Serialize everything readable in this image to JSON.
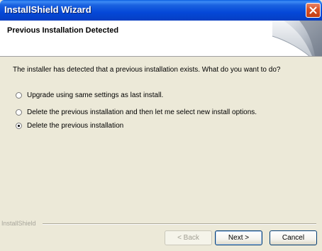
{
  "window": {
    "title": "InstallShield Wizard"
  },
  "header": {
    "title": "Previous Installation Detected"
  },
  "body": {
    "prompt": "The installer has detected that a previous installation exists.  What do you want to do?",
    "options": [
      {
        "label": "Upgrade using same settings as last install.",
        "selected": false
      },
      {
        "label": "Delete the previous installation and then let me select new install options.",
        "selected": false
      },
      {
        "label": "Delete the previous installation",
        "selected": true
      }
    ]
  },
  "footer": {
    "brand": "InstallShield",
    "back_label": "< Back",
    "next_label": "Next >",
    "cancel_label": "Cancel"
  },
  "icons": {
    "close": "close-icon",
    "radio": "radio-icon"
  },
  "colors": {
    "titlebar": "#0548d8",
    "close_button": "#d9542a",
    "dialog_background": "#ece9d8"
  }
}
